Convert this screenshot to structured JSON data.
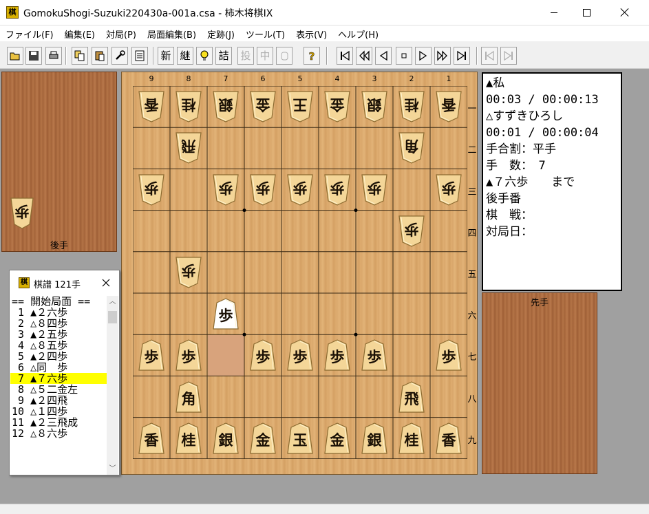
{
  "window": {
    "title": "GomokuShogi-Suzuki220430a-001a.csa - 柿木将棋IX",
    "icon_char": "棋"
  },
  "menu": [
    "ファイル(F)",
    "編集(E)",
    "対局(P)",
    "局面編集(B)",
    "定跡(J)",
    "ツール(T)",
    "表示(V)",
    "ヘルプ(H)"
  ],
  "toolbar": {
    "buttons": [
      {
        "name": "open-icon",
        "label": "",
        "enabled": true
      },
      {
        "name": "save-icon",
        "label": "",
        "enabled": true
      },
      {
        "name": "print-icon",
        "label": "",
        "enabled": true
      },
      {
        "name": "copy-icon",
        "label": "",
        "enabled": true
      },
      {
        "name": "paste-icon",
        "label": "",
        "enabled": true
      },
      {
        "name": "tools-icon",
        "label": "",
        "enabled": true
      },
      {
        "name": "list-icon",
        "label": "",
        "enabled": true
      },
      {
        "name": "new-game-button",
        "label": "新",
        "enabled": true
      },
      {
        "name": "continue-button",
        "label": "継",
        "enabled": true
      },
      {
        "name": "hint-icon",
        "label": "",
        "enabled": true
      },
      {
        "name": "tsume-button",
        "label": "詰",
        "enabled": true
      },
      {
        "name": "resign-button",
        "label": "投",
        "enabled": false
      },
      {
        "name": "interrupt-button",
        "label": "中",
        "enabled": false
      },
      {
        "name": "hand-icon",
        "label": "",
        "enabled": false
      },
      {
        "name": "help-icon",
        "label": "",
        "enabled": true
      },
      {
        "name": "first-move-icon",
        "label": "",
        "enabled": true
      },
      {
        "name": "back-10-icon",
        "label": "",
        "enabled": true
      },
      {
        "name": "back-1-icon",
        "label": "",
        "enabled": true
      },
      {
        "name": "stop-icon",
        "label": "",
        "enabled": true
      },
      {
        "name": "forward-1-icon",
        "label": "",
        "enabled": true
      },
      {
        "name": "forward-10-icon",
        "label": "",
        "enabled": true
      },
      {
        "name": "last-move-icon",
        "label": "",
        "enabled": true
      },
      {
        "name": "branch-back-icon",
        "label": "",
        "enabled": false
      },
      {
        "name": "branch-forward-icon",
        "label": "",
        "enabled": false
      }
    ]
  },
  "board": {
    "col_labels": [
      "9",
      "8",
      "7",
      "6",
      "5",
      "4",
      "3",
      "2",
      "1"
    ],
    "row_labels": [
      "一",
      "二",
      "三",
      "四",
      "五",
      "六",
      "七",
      "八",
      "九"
    ],
    "pieces": [
      {
        "file": 9,
        "rank": 1,
        "char": "香",
        "side": "gote"
      },
      {
        "file": 8,
        "rank": 1,
        "char": "桂",
        "side": "gote"
      },
      {
        "file": 7,
        "rank": 1,
        "char": "銀",
        "side": "gote"
      },
      {
        "file": 6,
        "rank": 1,
        "char": "金",
        "side": "gote"
      },
      {
        "file": 5,
        "rank": 1,
        "char": "王",
        "side": "gote"
      },
      {
        "file": 4,
        "rank": 1,
        "char": "金",
        "side": "gote"
      },
      {
        "file": 3,
        "rank": 1,
        "char": "銀",
        "side": "gote"
      },
      {
        "file": 2,
        "rank": 1,
        "char": "桂",
        "side": "gote"
      },
      {
        "file": 1,
        "rank": 1,
        "char": "香",
        "side": "gote"
      },
      {
        "file": 8,
        "rank": 2,
        "char": "飛",
        "side": "gote"
      },
      {
        "file": 2,
        "rank": 2,
        "char": "角",
        "side": "gote"
      },
      {
        "file": 9,
        "rank": 3,
        "char": "歩",
        "side": "gote"
      },
      {
        "file": 7,
        "rank": 3,
        "char": "歩",
        "side": "gote"
      },
      {
        "file": 6,
        "rank": 3,
        "char": "歩",
        "side": "gote"
      },
      {
        "file": 5,
        "rank": 3,
        "char": "歩",
        "side": "gote"
      },
      {
        "file": 4,
        "rank": 3,
        "char": "歩",
        "side": "gote"
      },
      {
        "file": 3,
        "rank": 3,
        "char": "歩",
        "side": "gote"
      },
      {
        "file": 1,
        "rank": 3,
        "char": "歩",
        "side": "gote"
      },
      {
        "file": 2,
        "rank": 4,
        "char": "歩",
        "side": "gote"
      },
      {
        "file": 8,
        "rank": 5,
        "char": "歩",
        "side": "gote"
      },
      {
        "file": 7,
        "rank": 6,
        "char": "歩",
        "side": "sente",
        "last": true
      },
      {
        "file": 9,
        "rank": 7,
        "char": "歩",
        "side": "sente"
      },
      {
        "file": 8,
        "rank": 7,
        "char": "歩",
        "side": "sente"
      },
      {
        "file": 6,
        "rank": 7,
        "char": "歩",
        "side": "sente"
      },
      {
        "file": 5,
        "rank": 7,
        "char": "歩",
        "side": "sente"
      },
      {
        "file": 4,
        "rank": 7,
        "char": "歩",
        "side": "sente"
      },
      {
        "file": 3,
        "rank": 7,
        "char": "歩",
        "side": "sente"
      },
      {
        "file": 1,
        "rank": 7,
        "char": "歩",
        "side": "sente"
      },
      {
        "file": 8,
        "rank": 8,
        "char": "角",
        "side": "sente"
      },
      {
        "file": 2,
        "rank": 8,
        "char": "飛",
        "side": "sente"
      },
      {
        "file": 9,
        "rank": 9,
        "char": "香",
        "side": "sente"
      },
      {
        "file": 8,
        "rank": 9,
        "char": "桂",
        "side": "sente"
      },
      {
        "file": 7,
        "rank": 9,
        "char": "銀",
        "side": "sente"
      },
      {
        "file": 6,
        "rank": 9,
        "char": "金",
        "side": "sente"
      },
      {
        "file": 5,
        "rank": 9,
        "char": "玉",
        "side": "sente"
      },
      {
        "file": 4,
        "rank": 9,
        "char": "金",
        "side": "sente"
      },
      {
        "file": 3,
        "rank": 9,
        "char": "銀",
        "side": "sente"
      },
      {
        "file": 2,
        "rank": 9,
        "char": "桂",
        "side": "sente"
      },
      {
        "file": 1,
        "rank": 9,
        "char": "香",
        "side": "sente"
      }
    ],
    "last_move": {
      "file": 7,
      "rank": 7
    }
  },
  "gote_hand": {
    "label": "後手",
    "pieces": [
      "歩"
    ]
  },
  "sente_hand": {
    "label": "先手",
    "pieces": []
  },
  "info": {
    "lines": [
      "▲私",
      "00:03 / 00:00:13",
      "△すずきひろし",
      "00:01 / 00:00:04",
      "手合割：平手",
      "手　数：　7",
      "▲７六歩　　まで",
      "後手番",
      "棋　戦：",
      "対局日："
    ]
  },
  "kifu": {
    "title": "棋譜 121手",
    "icon_char": "棋",
    "rows": [
      {
        "text": "== 開始局面 ==",
        "selected": false
      },
      {
        "text": " 1 ▲２六歩",
        "selected": false
      },
      {
        "text": " 2 △８四歩",
        "selected": false
      },
      {
        "text": " 3 ▲２五歩",
        "selected": false
      },
      {
        "text": " 4 △８五歩",
        "selected": false
      },
      {
        "text": " 5 ▲２四歩",
        "selected": false
      },
      {
        "text": " 6 △同　歩",
        "selected": false
      },
      {
        "text": " 7 ▲７六歩",
        "selected": true
      },
      {
        "text": " 8 △５二金左",
        "selected": false
      },
      {
        "text": " 9 ▲２四飛",
        "selected": false
      },
      {
        "text": "10 △１四歩",
        "selected": false
      },
      {
        "text": "11 ▲２三飛成",
        "selected": false
      },
      {
        "text": "12 △８六歩",
        "selected": false
      }
    ]
  }
}
